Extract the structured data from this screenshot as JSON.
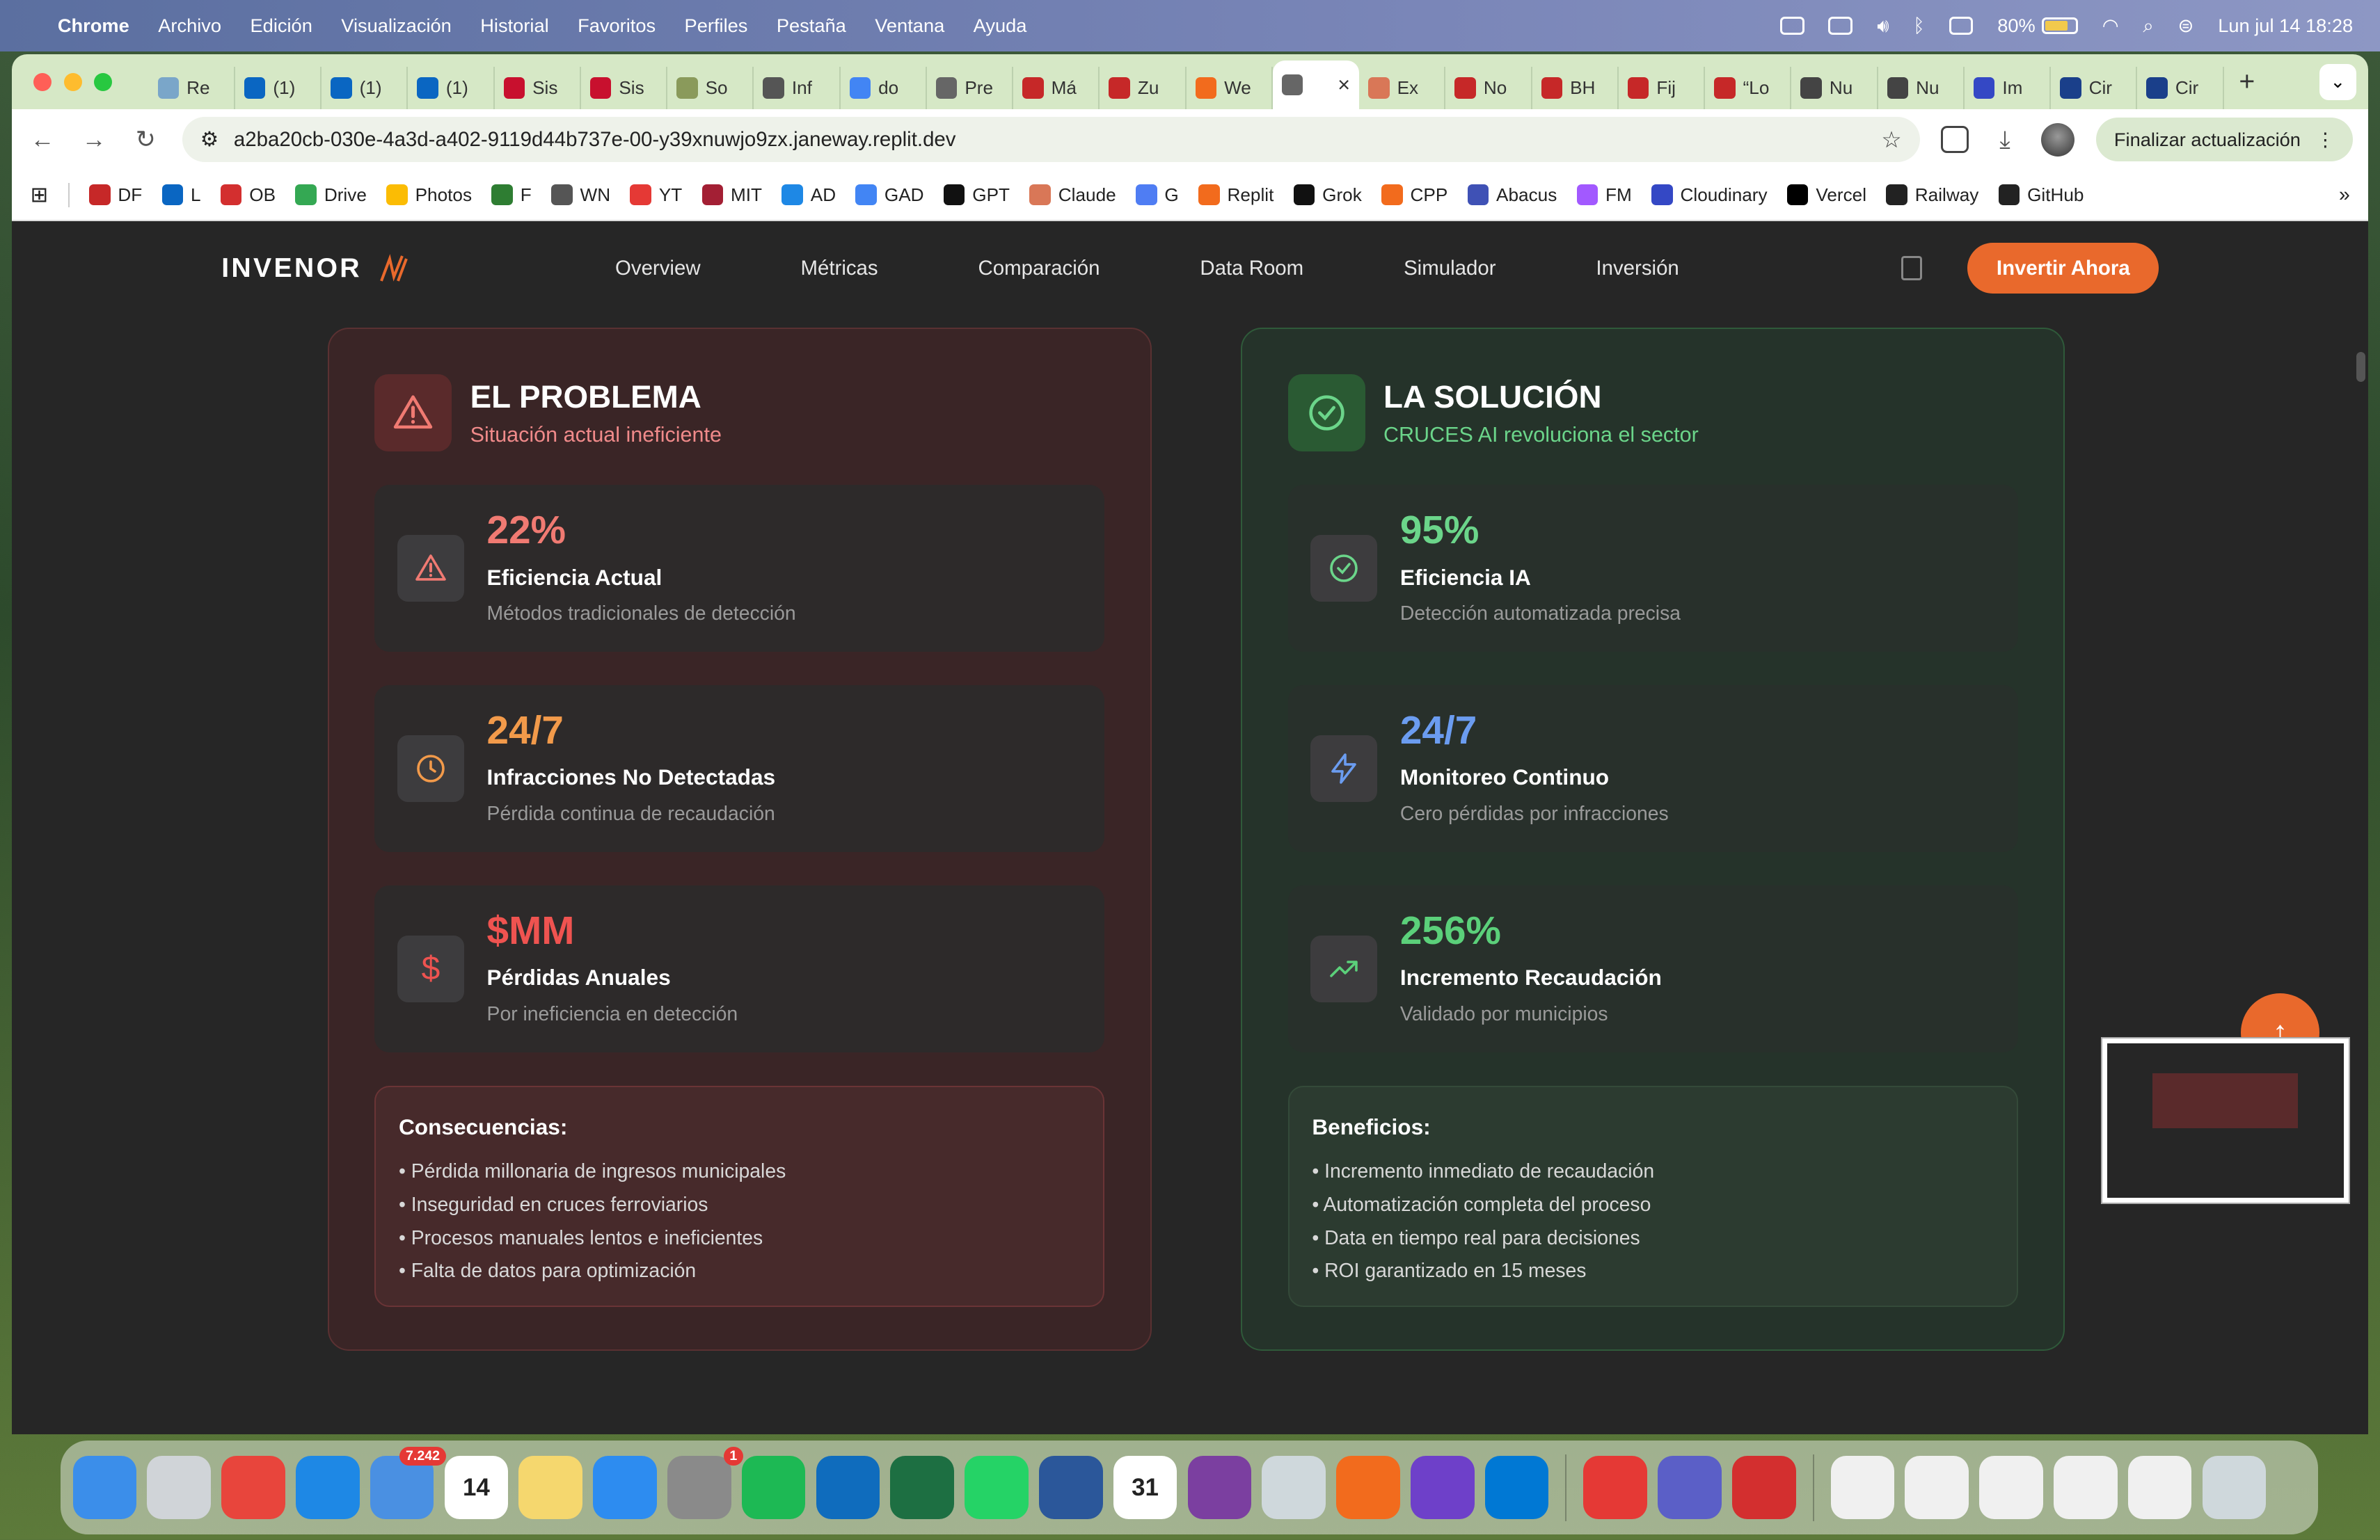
{
  "menubar": {
    "app": "Chrome",
    "items": [
      "Archivo",
      "Edición",
      "Visualización",
      "Historial",
      "Favoritos",
      "Perfiles",
      "Pestaña",
      "Ventana",
      "Ayuda"
    ],
    "battery": "80%",
    "datetime": "Lun jul 14  18:28"
  },
  "tabs": [
    {
      "label": "Re",
      "color": "#7aa6c9"
    },
    {
      "label": "(1)",
      "color": "#0a66c2"
    },
    {
      "label": "(1)",
      "color": "#0a66c2"
    },
    {
      "label": "(1)",
      "color": "#0a66c2"
    },
    {
      "label": "Sis",
      "color": "#c8102e"
    },
    {
      "label": "Sis",
      "color": "#c8102e"
    },
    {
      "label": "So",
      "color": "#8a9a5b"
    },
    {
      "label": "Inf",
      "color": "#555"
    },
    {
      "label": "do",
      "color": "#4285f4"
    },
    {
      "label": "Pre",
      "color": "#666"
    },
    {
      "label": "Má",
      "color": "#c62828"
    },
    {
      "label": "Zu",
      "color": "#c62828"
    },
    {
      "label": "We",
      "color": "#f26b1d"
    },
    {
      "label": "",
      "color": "#666",
      "active": true
    },
    {
      "label": "Ex",
      "color": "#d97757"
    },
    {
      "label": "No",
      "color": "#c62828"
    },
    {
      "label": "BH",
      "color": "#c62828"
    },
    {
      "label": "Fij",
      "color": "#c62828"
    },
    {
      "label": "“Lo",
      "color": "#c62828"
    },
    {
      "label": "Nu",
      "color": "#444"
    },
    {
      "label": "Nu",
      "color": "#444"
    },
    {
      "label": "Im",
      "color": "#3448c5"
    },
    {
      "label": "Cir",
      "color": "#1a3f8a"
    },
    {
      "label": "Cir",
      "color": "#1a3f8a"
    }
  ],
  "address": {
    "url": "a2ba20cb-030e-4a3d-a402-9119d44b737e-00-y39xnuwjo9zx.janeway.replit.dev",
    "update_button": "Finalizar actualización"
  },
  "bookmarks": [
    {
      "label": "DF",
      "color": "#c62828"
    },
    {
      "label": "L",
      "color": "#0a66c2"
    },
    {
      "label": "OB",
      "color": "#d32f2f"
    },
    {
      "label": "Drive",
      "color": "#34a853"
    },
    {
      "label": "Photos",
      "color": "#fbbc04"
    },
    {
      "label": "F",
      "color": "#2e7d32"
    },
    {
      "label": "WN",
      "color": "#555"
    },
    {
      "label": "YT",
      "color": "#e53935"
    },
    {
      "label": "MIT",
      "color": "#a31f34"
    },
    {
      "label": "AD",
      "color": "#1e88e5"
    },
    {
      "label": "GAD",
      "color": "#4285f4"
    },
    {
      "label": "GPT",
      "color": "#111"
    },
    {
      "label": "Claude",
      "color": "#d97757"
    },
    {
      "label": "G",
      "color": "#4f7df3"
    },
    {
      "label": "Replit",
      "color": "#f26b1d"
    },
    {
      "label": "Grok",
      "color": "#111"
    },
    {
      "label": "CPP",
      "color": "#f26b1d"
    },
    {
      "label": "Abacus",
      "color": "#3f51b5"
    },
    {
      "label": "FM",
      "color": "#a259ff"
    },
    {
      "label": "Cloudinary",
      "color": "#3448c5"
    },
    {
      "label": "Vercel",
      "color": "#000"
    },
    {
      "label": "Railway",
      "color": "#222"
    },
    {
      "label": "GitHub",
      "color": "#222"
    }
  ],
  "site": {
    "logo": "INVENOR",
    "nav": [
      "Overview",
      "Métricas",
      "Comparación",
      "Data Room",
      "Simulador",
      "Inversión"
    ],
    "cta": "Invertir Ahora",
    "accent": "#e9692c"
  },
  "problem": {
    "title": "EL PROBLEMA",
    "subtitle": "Situación actual ineficiente",
    "cards": [
      {
        "value": "22%",
        "label": "Eficiencia Actual",
        "desc": "Métodos tradicionales de detección",
        "color": "#f07a72",
        "icon": "warning-icon"
      },
      {
        "value": "24/7",
        "label": "Infracciones No Detectadas",
        "desc": "Pérdida continua de recaudación",
        "color": "#f29a4a",
        "icon": "clock-icon"
      },
      {
        "value": "$MM",
        "label": "Pérdidas Anuales",
        "desc": "Por ineficiencia en detección",
        "color": "#ef5350",
        "icon": "dollar-icon"
      }
    ],
    "box_title": "Consecuencias:",
    "box_items": [
      "• Pérdida millonaria de ingresos municipales",
      "• Inseguridad en cruces ferroviarios",
      "• Procesos manuales lentos e ineficientes",
      "• Falta de datos para optimización"
    ]
  },
  "solution": {
    "title": "LA SOLUCIÓN",
    "subtitle": "CRUCES AI revoluciona el sector",
    "cards": [
      {
        "value": "95%",
        "label": "Eficiencia IA",
        "desc": "Detección automatizada precisa",
        "color": "#6bd58a",
        "icon": "check-circle-icon"
      },
      {
        "value": "24/7",
        "label": "Monitoreo Continuo",
        "desc": "Cero pérdidas por infracciones",
        "color": "#6b9cf0",
        "icon": "bolt-icon"
      },
      {
        "value": "256%",
        "label": "Incremento Recaudación",
        "desc": "Validado por municipios",
        "color": "#5bd07a",
        "icon": "trending-up-icon"
      }
    ],
    "box_title": "Beneficios:",
    "box_items": [
      "• Incremento inmediato de recaudación",
      "• Automatización completa del proceso",
      "• Data en tiempo real para decisiones",
      "• ROI garantizado en 15 meses"
    ]
  },
  "dock": [
    {
      "name": "finder",
      "color": "#3b8eea"
    },
    {
      "name": "launchpad",
      "color": "#d0d4d8"
    },
    {
      "name": "chrome",
      "color": "#e8453c"
    },
    {
      "name": "safari",
      "color": "#1e88e5"
    },
    {
      "name": "mail",
      "color": "#4a90e2",
      "badge": "7.242"
    },
    {
      "name": "calendar",
      "color": "#ffffff",
      "text": "14"
    },
    {
      "name": "notes",
      "color": "#f5d76e"
    },
    {
      "name": "keynote",
      "color": "#2d8cf0"
    },
    {
      "name": "system-settings",
      "color": "#8a8a8a",
      "badge": "1"
    },
    {
      "name": "spotify",
      "color": "#1db954"
    },
    {
      "name": "outlook",
      "color": "#0f6cbd"
    },
    {
      "name": "excel",
      "color": "#1d6f42"
    },
    {
      "name": "whatsapp",
      "color": "#25d366"
    },
    {
      "name": "word",
      "color": "#2b579a"
    },
    {
      "name": "calendar-31",
      "color": "#ffffff",
      "text": "31"
    },
    {
      "name": "circle-app",
      "color": "#7b3fa0"
    },
    {
      "name": "iphone-mirroring",
      "color": "#cfd8dc"
    },
    {
      "name": "replit",
      "color": "#f26b1d"
    },
    {
      "name": "github-desktop",
      "color": "#6e40c9"
    },
    {
      "name": "vscode",
      "color": "#0078d4"
    },
    {
      "name": "acrobat",
      "color": "#e53935"
    },
    {
      "name": "teams",
      "color": "#5b5fc7"
    },
    {
      "name": "photo-booth",
      "color": "#d32f2f"
    },
    {
      "name": "file-1",
      "color": "#f0f0f0"
    },
    {
      "name": "file-2",
      "color": "#f0f0f0"
    },
    {
      "name": "file-3",
      "color": "#f0f0f0"
    },
    {
      "name": "file-4",
      "color": "#f0f0f0"
    },
    {
      "name": "file-5",
      "color": "#f0f0f0"
    },
    {
      "name": "trash",
      "color": "#cfd8dc"
    }
  ]
}
